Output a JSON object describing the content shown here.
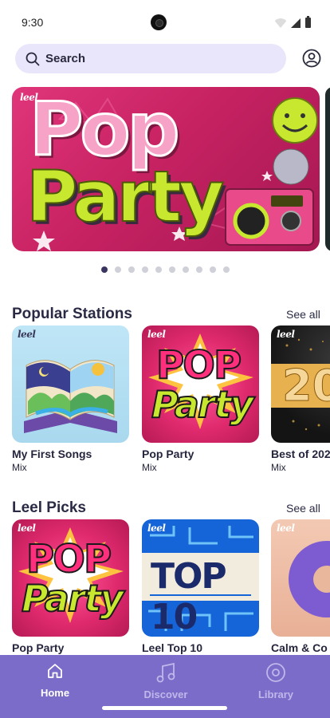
{
  "status_bar": {
    "time": "9:30"
  },
  "search": {
    "label": "Search"
  },
  "hero": {
    "logo": "leel",
    "art_title_line1": "Pop",
    "art_title_line2": "Party",
    "page_count": 10,
    "active_page": 1
  },
  "popular_stations": {
    "title": "Popular Stations",
    "see_all": "See all",
    "items": [
      {
        "title": "My First Songs",
        "subtitle": "Mix",
        "logo": "leel"
      },
      {
        "title": "Pop Party",
        "subtitle": "Mix",
        "logo": "leel",
        "art_line1": "POP",
        "art_line2": "Party"
      },
      {
        "title": "Best of 202",
        "subtitle": "Mix",
        "logo": "leel",
        "art_text": "20"
      }
    ]
  },
  "leel_picks": {
    "title": "Leel Picks",
    "see_all": "See all",
    "items": [
      {
        "title": "Pop Party",
        "logo": "leel",
        "art_line1": "POP",
        "art_line2": "Party"
      },
      {
        "title": "Leel Top 10",
        "logo": "leel",
        "art_text": "TOP 10"
      },
      {
        "title": "Calm & Co",
        "logo": "leel"
      }
    ]
  },
  "bottom_nav": {
    "items": [
      {
        "label": "Home",
        "icon": "home-icon",
        "active": true
      },
      {
        "label": "Discover",
        "icon": "music-note-icon",
        "active": false
      },
      {
        "label": "Library",
        "icon": "record-icon",
        "active": false
      }
    ]
  },
  "colors": {
    "accent": "#7b6cc9",
    "search_bg": "#e9e6fb",
    "hero_pink": "#d62b6f",
    "lime": "#c8e830"
  }
}
